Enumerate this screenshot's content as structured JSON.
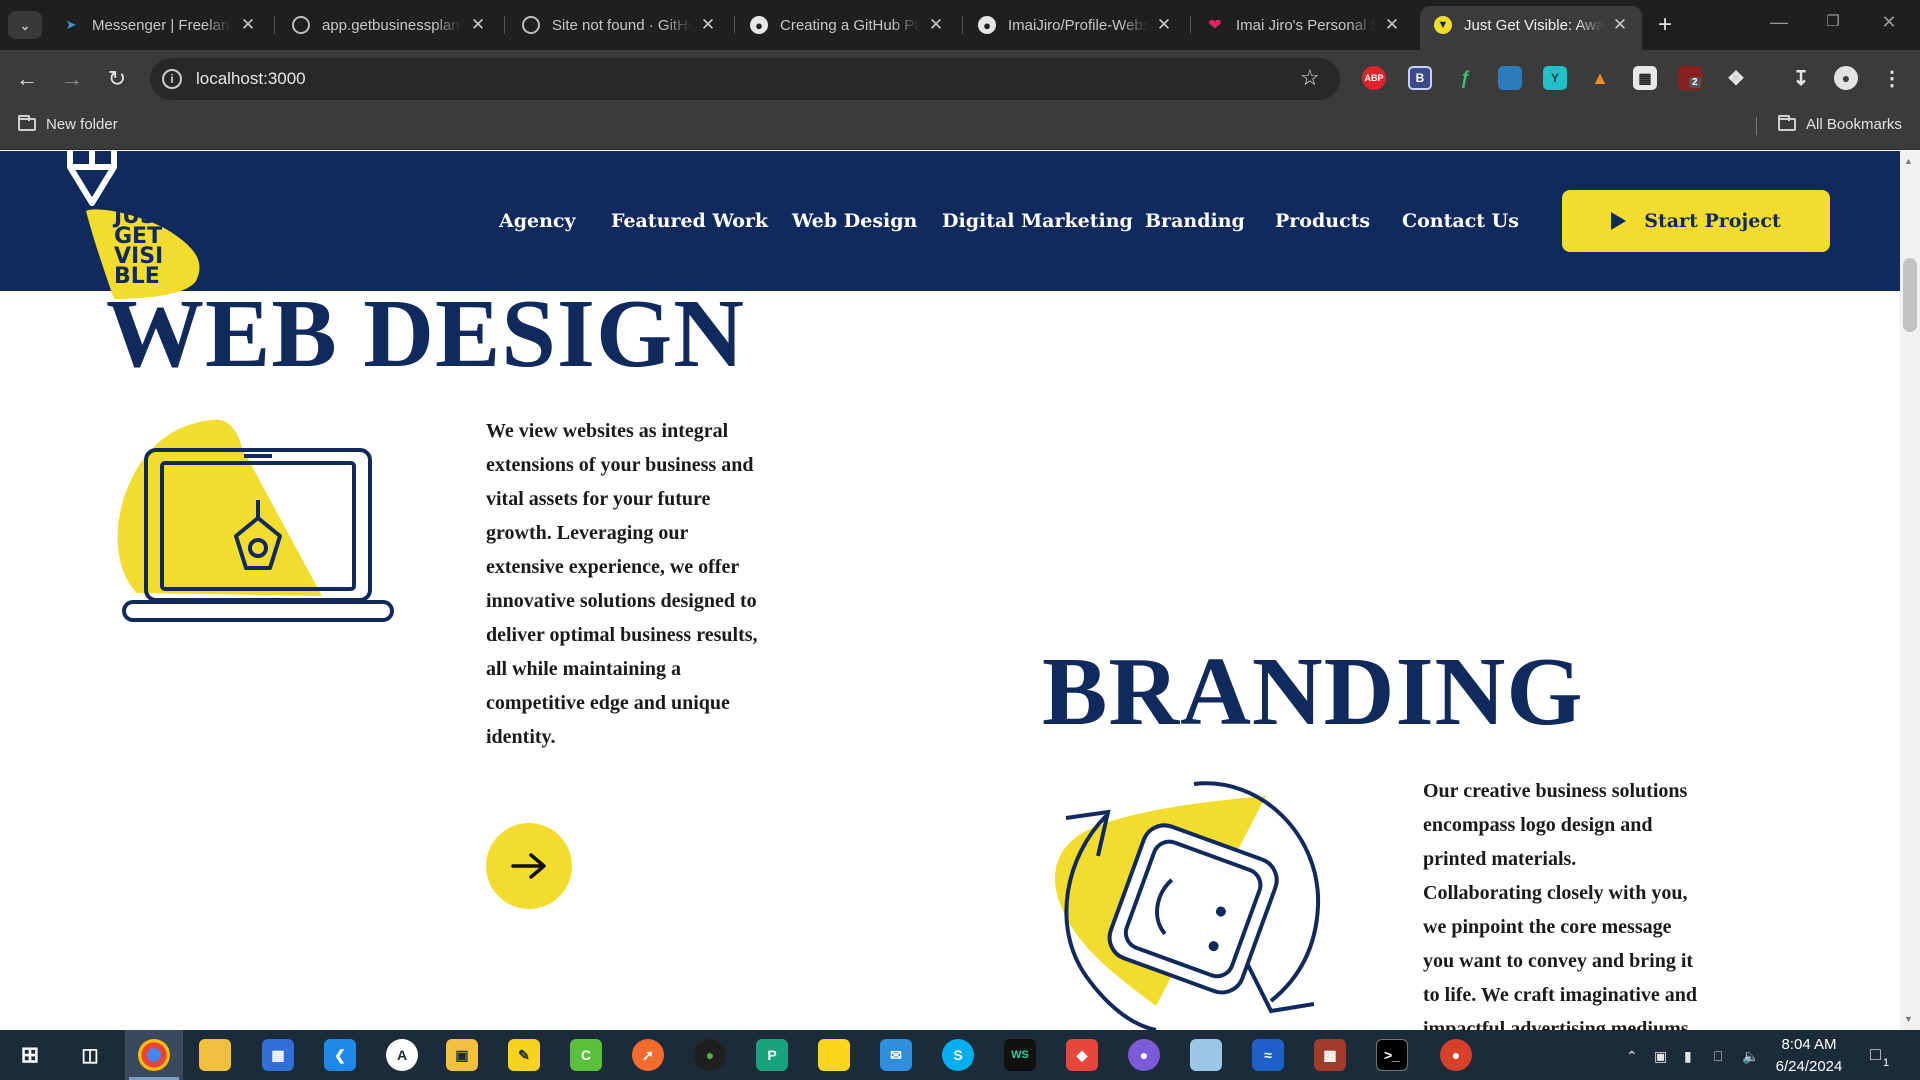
{
  "browser": {
    "tabs": [
      {
        "title": "Messenger | Freelancer",
        "favicon": "freelancer-icon",
        "active": false
      },
      {
        "title": "app.getbusinessplan",
        "favicon": "globe-icon",
        "active": false
      },
      {
        "title": "Site not found · GitHub",
        "favicon": "globe-icon",
        "active": false
      },
      {
        "title": "Creating a GitHub Pages",
        "favicon": "github-icon",
        "active": false
      },
      {
        "title": "ImaiJiro/Profile-Website",
        "favicon": "github-icon",
        "active": false
      },
      {
        "title": "Imai Jiro's Personal Site",
        "favicon": "heart-icon",
        "active": false
      },
      {
        "title": "Just Get Visible: Award",
        "favicon": "pointer-icon",
        "active": true
      }
    ],
    "url": "localhost:3000",
    "bookmarks": {
      "folder": "New folder",
      "all": "All Bookmarks"
    },
    "extension_badges": {
      "abp": "ABP",
      "b": "B",
      "notif_count": "2"
    }
  },
  "site": {
    "logo": {
      "line1": "JUST",
      "line2": "GET",
      "line3": "VISI",
      "line4": "BLE"
    },
    "nav": [
      "Agency",
      "Featured Work",
      "Web Design",
      "Digital Marketing",
      "Branding",
      "Products",
      "Contact Us"
    ],
    "cta_label": "Start Project",
    "colors": {
      "navy": "#112a5e",
      "yellow": "#f2dc2e"
    }
  },
  "sections": {
    "web_design": {
      "title": "WEB DESIGN",
      "lines": [
        "We view websites as integral",
        "extensions of your business and",
        "vital assets for your future",
        "growth. Leveraging our",
        "extensive experience, we offer",
        "innovative solutions designed to",
        "deliver optimal business results,",
        "all while maintaining a",
        "competitive edge and unique",
        "identity."
      ]
    },
    "branding": {
      "title": "BRANDING",
      "lines": [
        "Our creative business solutions",
        "encompass logo design and",
        "printed materials.",
        "Collaborating closely with you,",
        "we pinpoint the core message",
        "you want to convey and bring it",
        "to life. We craft imaginative and",
        "impactful advertising mediums"
      ]
    }
  },
  "taskbar": {
    "time": "8:04 AM",
    "date": "6/24/2024",
    "notification_count": "1",
    "ws_label": "WS"
  }
}
